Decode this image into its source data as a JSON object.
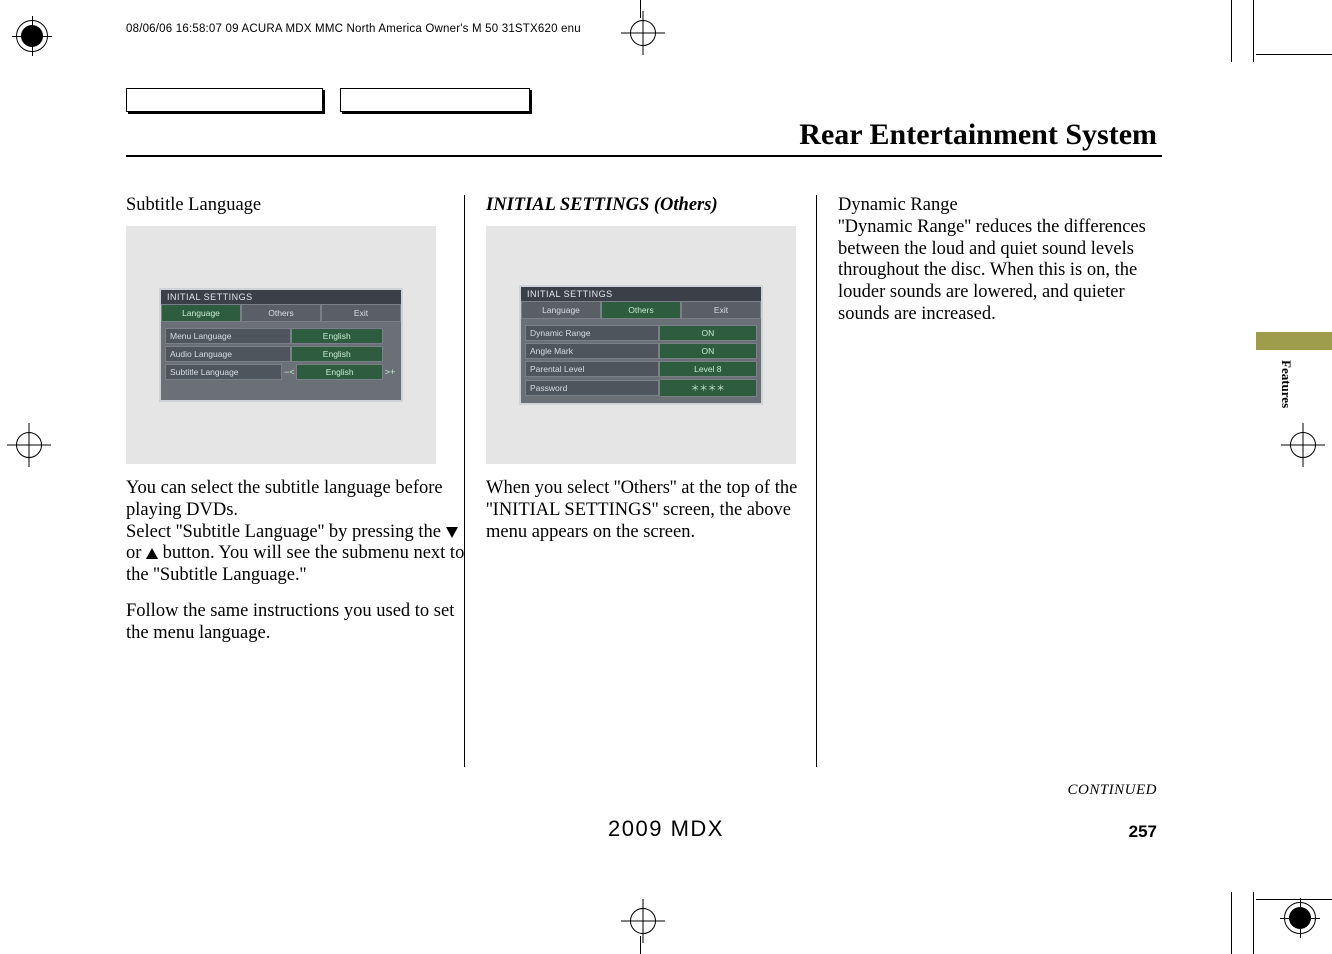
{
  "header": {
    "meta_line": "08/06/06 16:58:07   09 ACURA MDX MMC North America Owner's M 50 31STX620 enu"
  },
  "page_title": "Rear Entertainment System",
  "sidebar_tab": "Features",
  "footer": {
    "continued": "CONTINUED",
    "page_number": "257",
    "model_year": "2009  MDX"
  },
  "col1": {
    "heading": "Subtitle Language",
    "screenshot": {
      "title": "INITIAL SETTINGS",
      "tabs": {
        "language": "Language",
        "others": "Others",
        "exit": "Exit"
      },
      "rows": [
        {
          "label": "Menu Language",
          "value": "English"
        },
        {
          "label": "Audio Language",
          "value": "English"
        },
        {
          "label": "Subtitle Language",
          "value": "English"
        }
      ]
    },
    "para1_a": "You can select the subtitle language before playing DVDs.",
    "para1_b1": "Select ''Subtitle Language'' by pressing the ",
    "para1_b2": " or ",
    "para1_b3": " button. You will see the submenu next to the ''Subtitle Language.''",
    "para2": "Follow the same instructions you used to set the menu language."
  },
  "col2": {
    "heading": "INITIAL SETTINGS (Others)",
    "screenshot": {
      "title": "INITIAL SETTINGS",
      "tabs": {
        "language": "Language",
        "others": "Others",
        "exit": "Exit"
      },
      "rows": [
        {
          "label": "Dynamic Range",
          "value": "ON"
        },
        {
          "label": "Angle Mark",
          "value": "ON"
        },
        {
          "label": "Parental Level",
          "value": "Level 8"
        },
        {
          "label": "Password",
          "value": "＊＊＊＊"
        }
      ]
    },
    "para1": "When you select ''Others'' at the top of the ''INITIAL SETTINGS'' screen, the above menu appears on the screen."
  },
  "col3": {
    "heading": "Dynamic Range",
    "para1": "''Dynamic Range'' reduces the differences between the loud and quiet sound levels throughout the disc. When this is on, the louder sounds are lowered, and quieter sounds are increased."
  }
}
